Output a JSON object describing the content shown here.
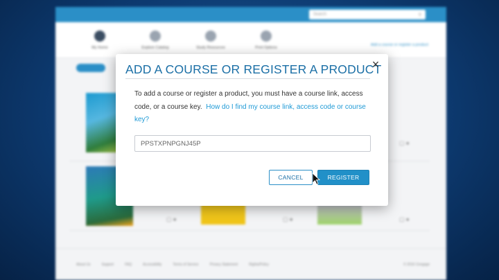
{
  "background": {
    "search": {
      "placeholder": "Search",
      "icon": "search-icon"
    },
    "nav": {
      "items": [
        {
          "label": "My Home",
          "icon": "home-icon"
        },
        {
          "label": "Explore Catalog",
          "icon": "catalog-icon"
        },
        {
          "label": "Study Resources",
          "icon": "resources-icon"
        },
        {
          "label": "Print Options",
          "icon": "print-icon"
        }
      ],
      "right_link": "Add a course or register a product"
    },
    "footer": {
      "links": [
        "About Us",
        "Support",
        "FAQ",
        "Accessibility",
        "Terms of Service",
        "Privacy Statement",
        "Rights/Policy"
      ],
      "copyright": "© 2016 Cengage"
    }
  },
  "modal": {
    "title": "ADD A COURSE OR REGISTER A PRODUCT",
    "close_glyph": "×",
    "body_text": "To add a course or register a product, you must have a course link, access code, or a course key.",
    "help_link": "How do I find my course link, access code or course key?",
    "code_input": {
      "value": "PPSTXPNPGNJ45P",
      "placeholder": ""
    },
    "cancel_label": "CANCEL",
    "register_label": "REGISTER"
  },
  "colors": {
    "accent": "#2190c8",
    "title": "#1b6fa6",
    "link": "#1f9ad6"
  }
}
